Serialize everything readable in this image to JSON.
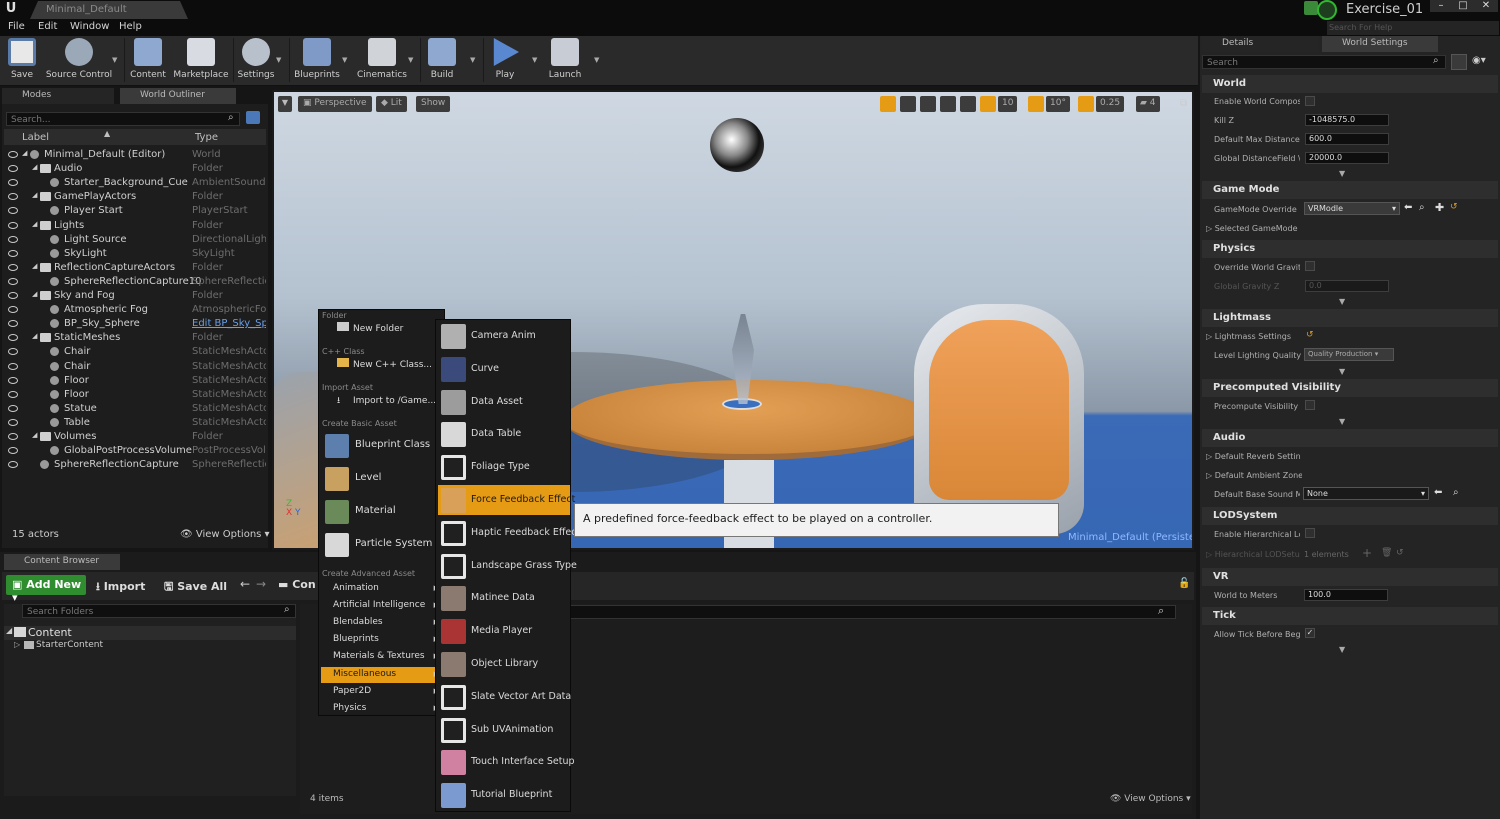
{
  "window": {
    "tab_title": "Minimal_Default",
    "project": "Exercise_01",
    "help_placeholder": "Search For Help"
  },
  "menubar": [
    "File",
    "Edit",
    "Window",
    "Help"
  ],
  "toolbar": {
    "save": "Save",
    "source_control": "Source Control",
    "content": "Content",
    "marketplace": "Marketplace",
    "settings": "Settings",
    "blueprints": "Blueprints",
    "cinematics": "Cinematics",
    "build": "Build",
    "play": "Play",
    "launch": "Launch"
  },
  "tabs": {
    "modes": "Modes",
    "world_outliner": "World Outliner"
  },
  "outliner": {
    "search_placeholder": "Search...",
    "col_label": "Label",
    "col_type": "Type",
    "rows": [
      {
        "label": "Minimal_Default (Editor)",
        "type": "World"
      },
      {
        "label": "Audio",
        "type": "Folder"
      },
      {
        "label": "Starter_Background_Cue",
        "type": "AmbientSound"
      },
      {
        "label": "GamePlayActors",
        "type": "Folder"
      },
      {
        "label": "Player Start",
        "type": "PlayerStart"
      },
      {
        "label": "Lights",
        "type": "Folder"
      },
      {
        "label": "Light Source",
        "type": "DirectionalLight"
      },
      {
        "label": "SkyLight",
        "type": "SkyLight"
      },
      {
        "label": "ReflectionCaptureActors",
        "type": "Folder"
      },
      {
        "label": "SphereReflectionCapture10",
        "type": "SphereReflection"
      },
      {
        "label": "Sky and Fog",
        "type": "Folder"
      },
      {
        "label": "Atmospheric Fog",
        "type": "AtmosphericFog"
      },
      {
        "label": "BP_Sky_Sphere",
        "type": "Edit BP_Sky_Sp"
      },
      {
        "label": "StaticMeshes",
        "type": "Folder"
      },
      {
        "label": "Chair",
        "type": "StaticMeshActor"
      },
      {
        "label": "Chair",
        "type": "StaticMeshActor"
      },
      {
        "label": "Floor",
        "type": "StaticMeshActor"
      },
      {
        "label": "Floor",
        "type": "StaticMeshActor"
      },
      {
        "label": "Statue",
        "type": "StaticMeshActor"
      },
      {
        "label": "Table",
        "type": "StaticMeshActor"
      },
      {
        "label": "Volumes",
        "type": "Folder"
      },
      {
        "label": "GlobalPostProcessVolume",
        "type": "PostProcessVol"
      },
      {
        "label": "SphereReflectionCapture",
        "type": "SphereReflection"
      }
    ],
    "actor_count": "15 actors",
    "view_options": "View Options"
  },
  "viewport": {
    "perspective": "Perspective",
    "lit": "Lit",
    "show": "Show",
    "grid_snap": "10",
    "rot_snap": "10°",
    "scale_snap": "0.25",
    "cam_speed": "4",
    "level_label": "Minimal_Default (Persistent)",
    "accent": "#e59b14"
  },
  "content_browser": {
    "tab": "Content Browser",
    "add_new": "Add New",
    "import": "Import",
    "save_all": "Save All",
    "path_crumb": "Con",
    "search_folders": "Search Folders",
    "tree": [
      "Content",
      "StarterContent"
    ],
    "items_count": "4 items",
    "view_options": "View Options"
  },
  "context_menu": {
    "hdr_folder": "Folder",
    "new_folder": "New Folder",
    "hdr_cpp": "C++ Class",
    "new_cpp": "New C++ Class...",
    "hdr_import": "Import Asset",
    "import_to": "Import to /Game...",
    "hdr_basic": "Create Basic Asset",
    "basic": [
      "Blueprint Class",
      "Level",
      "Material",
      "Particle System"
    ],
    "hdr_advanced": "Create Advanced Asset",
    "advanced": [
      "Animation",
      "Artificial Intelligence",
      "Blendables",
      "Blueprints",
      "Materials & Textures",
      "Miscellaneous",
      "Paper2D",
      "Physics"
    ]
  },
  "submenu": {
    "items": [
      "Camera Anim",
      "Curve",
      "Data Asset",
      "Data Table",
      "Foliage Type",
      "Force Feedback Effect",
      "Haptic Feedback Effect",
      "Landscape Grass Type",
      "Matinee Data",
      "Media Player",
      "Object Library",
      "Slate Vector Art Data",
      "Sub UVAnimation",
      "Touch Interface Setup",
      "Tutorial Blueprint"
    ],
    "tooltip": "A predefined force-feedback effect to be played on a controller."
  },
  "details": {
    "tab_details": "Details",
    "tab_world": "World Settings",
    "search_placeholder": "Search",
    "world": {
      "title": "World",
      "enable_world": "Enable World Compos",
      "kill_z": "Kill Z",
      "kill_z_val": "-1048575.0",
      "max_dist": "Default Max Distance",
      "max_dist_val": "600.0",
      "gdf": "Global DistanceField \\",
      "gdf_val": "20000.0"
    },
    "game_mode": {
      "title": "Game Mode",
      "override": "GameMode Override",
      "override_val": "VRModle",
      "selected": "Selected GameMode"
    },
    "physics": {
      "title": "Physics",
      "override_gravity": "Override World Gravity",
      "global_gravity": "Global Gravity Z",
      "global_gravity_val": "0.0"
    },
    "lightmass": {
      "title": "Lightmass",
      "settings": "Lightmass Settings",
      "quality": "Level Lighting Quality",
      "quality_val": "Quality Production"
    },
    "precomputed": {
      "title": "Precomputed Visibility",
      "precompute": "Precompute Visibility"
    },
    "audio": {
      "title": "Audio",
      "reverb": "Default Reverb Settin",
      "ambient": "Default Ambient Zone",
      "base_sound": "Default Base Sound M",
      "base_sound_val": "None"
    },
    "lod": {
      "title": "LODSystem",
      "enable": "Enable Hierarchical Lc",
      "hier": "Hierarchical LODSetu",
      "hier_val": "1 elements"
    },
    "vr": {
      "title": "VR",
      "wtm": "World to Meters",
      "wtm_val": "100.0"
    },
    "tick": {
      "title": "Tick",
      "allow": "Allow Tick Before Beg"
    }
  }
}
